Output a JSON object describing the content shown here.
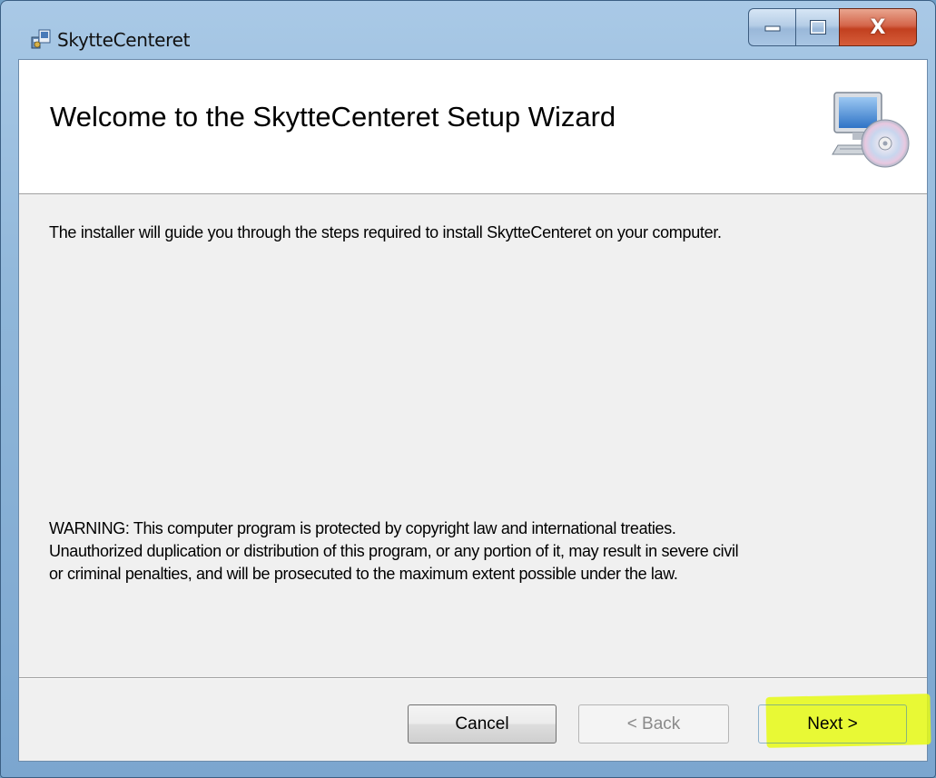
{
  "window": {
    "title": "SkytteCenteret",
    "icon": "installer-package-icon",
    "controls": {
      "minimize_icon": "minimize-icon",
      "maximize_icon": "maximize-icon",
      "close_label": "X"
    }
  },
  "banner": {
    "title": "Welcome to the SkytteCenteret Setup Wizard",
    "icon": "computer-cd-icon"
  },
  "body": {
    "intro": "The installer will guide you through the steps required to install SkytteCenteret on your computer.",
    "warning_lines": [
      "WARNING: This computer program is protected by copyright law and international treaties.",
      "Unauthorized duplication or distribution of this program, or any portion of it, may result in severe civil",
      "or criminal penalties, and will be prosecuted to the maximum extent possible under the law."
    ]
  },
  "buttons": {
    "cancel": "Cancel",
    "back": "< Back",
    "next": "Next >"
  },
  "colors": {
    "highlight": "#e6fa14",
    "titlebar": "#a9c9e6",
    "close_button": "#c2401f"
  }
}
